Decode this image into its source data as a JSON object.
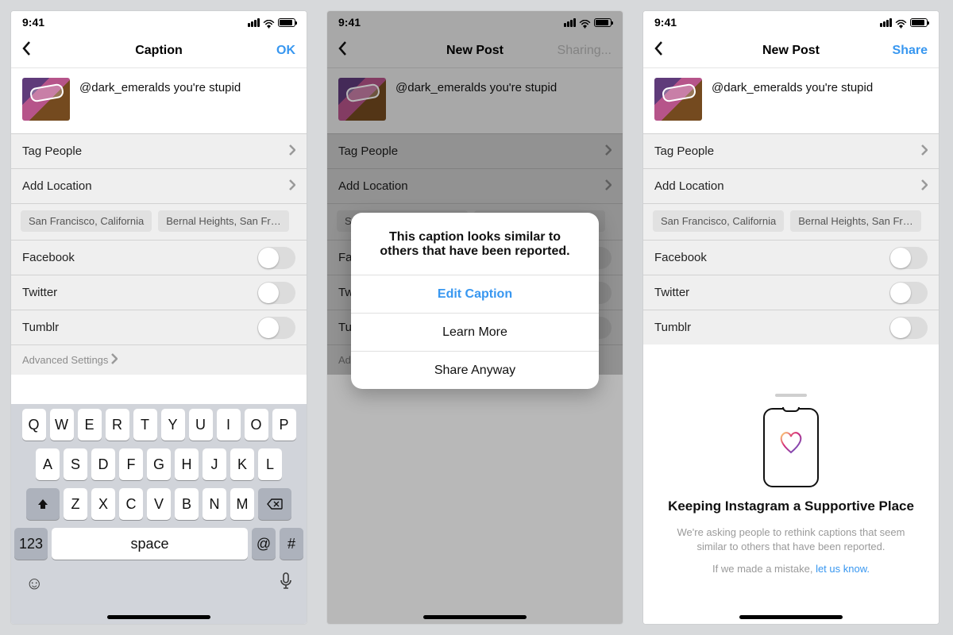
{
  "status": {
    "time": "9:41"
  },
  "screen1": {
    "nav": {
      "title": "Caption",
      "action": "OK"
    },
    "caption": "@dark_emeralds you're stupid",
    "rows": {
      "tag": "Tag People",
      "loc": "Add Location"
    },
    "chips": [
      "San Francisco, California",
      "Bernal Heights, San Fr…"
    ],
    "share": {
      "fb": "Facebook",
      "tw": "Twitter",
      "tb": "Tumblr"
    },
    "advanced": "Advanced Settings",
    "keyboard": {
      "r1": [
        "Q",
        "W",
        "E",
        "R",
        "T",
        "Y",
        "U",
        "I",
        "O",
        "P"
      ],
      "r2": [
        "A",
        "S",
        "D",
        "F",
        "G",
        "H",
        "J",
        "K",
        "L"
      ],
      "r3": [
        "Z",
        "X",
        "C",
        "V",
        "B",
        "N",
        "M"
      ],
      "num": "123",
      "space": "space",
      "at": "@",
      "hash": "#"
    }
  },
  "screen2": {
    "nav": {
      "title": "New Post",
      "action": "Sharing..."
    },
    "alert": {
      "message": "This caption looks similar to others that have been reported.",
      "opt1": "Edit Caption",
      "opt2": "Learn More",
      "opt3": "Share Anyway"
    }
  },
  "screen3": {
    "nav": {
      "title": "New Post",
      "action": "Share"
    },
    "sheet": {
      "title": "Keeping Instagram a Supportive Place",
      "body": "We're asking people to rethink captions that seem similar to others that have been reported.",
      "mistake_prefix": "If we made a mistake, ",
      "mistake_link": "let us know."
    }
  }
}
